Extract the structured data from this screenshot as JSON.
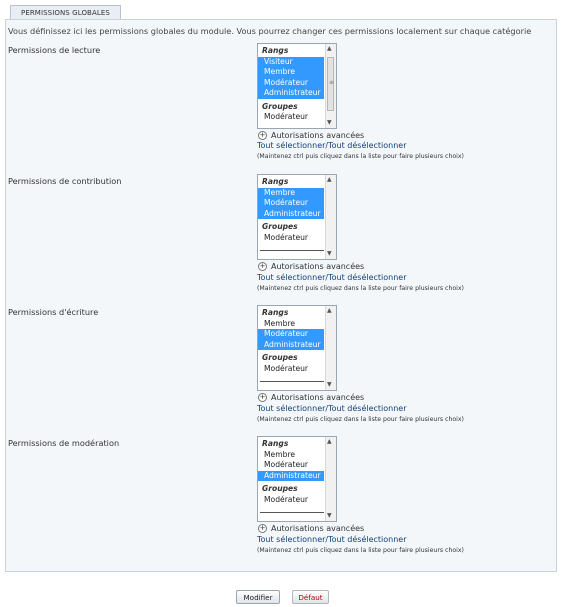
{
  "legend": "PERMISSIONS GLOBALES",
  "intro": "Vous définissez ici les permissions globales du module. Vous pourrez changer ces permissions localement sur chaque catégorie",
  "sections": [
    {
      "label": "Permissions de lecture",
      "ranks_header": "Rangs",
      "ranks": [
        {
          "label": "Visiteur",
          "selected": true
        },
        {
          "label": "Membre",
          "selected": true
        },
        {
          "label": "Modérateur",
          "selected": true
        },
        {
          "label": "Administrateur",
          "selected": true
        }
      ],
      "groups_header": "Groupes",
      "groups": [
        {
          "label": "Modérateur",
          "selected": false
        }
      ],
      "advanced": "Autorisations avancées",
      "select_all": "Tout sélectionner/Tout désélectionner",
      "hint": "(Maintenez ctrl puis cliquez dans la liste pour faire plusieurs choix)"
    },
    {
      "label": "Permissions de contribution",
      "ranks_header": "Rangs",
      "ranks": [
        {
          "label": "Membre",
          "selected": true
        },
        {
          "label": "Modérateur",
          "selected": true
        },
        {
          "label": "Administrateur",
          "selected": true
        }
      ],
      "groups_header": "Groupes",
      "groups": [
        {
          "label": "Modérateur",
          "selected": false
        }
      ],
      "advanced": "Autorisations avancées",
      "select_all": "Tout sélectionner/Tout désélectionner",
      "hint": "(Maintenez ctrl puis cliquez dans la liste pour faire plusieurs choix)"
    },
    {
      "label": "Permissions d'écriture",
      "ranks_header": "Rangs",
      "ranks": [
        {
          "label": "Membre",
          "selected": false
        },
        {
          "label": "Modérateur",
          "selected": true
        },
        {
          "label": "Administrateur",
          "selected": true
        }
      ],
      "groups_header": "Groupes",
      "groups": [
        {
          "label": "Modérateur",
          "selected": false
        }
      ],
      "advanced": "Autorisations avancées",
      "select_all": "Tout sélectionner/Tout désélectionner",
      "hint": "(Maintenez ctrl puis cliquez dans la liste pour faire plusieurs choix)"
    },
    {
      "label": "Permissions de modération",
      "ranks_header": "Rangs",
      "ranks": [
        {
          "label": "Membre",
          "selected": false
        },
        {
          "label": "Modérateur",
          "selected": false
        },
        {
          "label": "Administrateur",
          "selected": true
        }
      ],
      "groups_header": "Groupes",
      "groups": [
        {
          "label": "Modérateur",
          "selected": false
        }
      ],
      "advanced": "Autorisations avancées",
      "select_all": "Tout sélectionner/Tout désélectionner",
      "hint": "(Maintenez ctrl puis cliquez dans la liste pour faire plusieurs choix)"
    }
  ],
  "buttons": {
    "submit": "Modifier",
    "reset": "Défaut"
  },
  "colors": {
    "selection": "#3399ff",
    "link": "#123f76",
    "reset": "#b50000"
  }
}
